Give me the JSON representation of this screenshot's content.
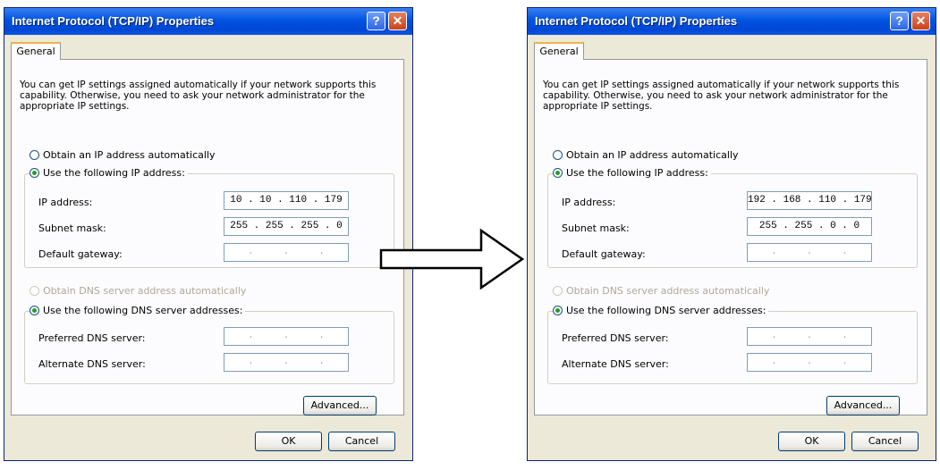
{
  "dialogs": [
    {
      "title": "Internet Protocol (TCP/IP) Properties",
      "help_glyph": "?",
      "close_glyph": "✕",
      "tab": "General",
      "description": "You can get IP settings assigned automatically if your network supports this capability. Otherwise, you need to ask your network administrator for the appropriate IP settings.",
      "radio_auto_ip": "Obtain an IP address automatically",
      "radio_manual_ip": "Use the following IP address:",
      "ip_label": "IP address:",
      "ip_value": "10 . 10 . 110 . 179",
      "subnet_label": "Subnet mask:",
      "subnet_value": "255 . 255 . 255 . 0",
      "gateway_label": "Default gateway:",
      "gateway_value": ".     .     .",
      "radio_auto_dns": "Obtain DNS server address automatically",
      "radio_manual_dns": "Use the following DNS server addresses:",
      "preferred_dns_label": "Preferred DNS server:",
      "preferred_dns_value": ".     .     .",
      "alternate_dns_label": "Alternate DNS server:",
      "alternate_dns_value": ".     .     .",
      "advanced_button": "Advanced...",
      "ok_button": "OK",
      "cancel_button": "Cancel"
    },
    {
      "title": "Internet Protocol (TCP/IP) Properties",
      "help_glyph": "?",
      "close_glyph": "✕",
      "tab": "General",
      "description": "You can get IP settings assigned automatically if your network supports this capability. Otherwise, you need to ask your network administrator for the appropriate IP settings.",
      "radio_auto_ip": "Obtain an IP address automatically",
      "radio_manual_ip": "Use the following IP address:",
      "ip_label": "IP address:",
      "ip_value": "192 . 168 . 110 . 179",
      "subnet_label": "Subnet mask:",
      "subnet_value": "255 . 255 . 0 . 0",
      "gateway_label": "Default gateway:",
      "gateway_value": ".     .     .",
      "radio_auto_dns": "Obtain DNS server address automatically",
      "radio_manual_dns": "Use the following DNS server addresses:",
      "preferred_dns_label": "Preferred DNS server:",
      "preferred_dns_value": ".     .     .",
      "alternate_dns_label": "Alternate DNS server:",
      "alternate_dns_value": ".     .     .",
      "advanced_button": "Advanced...",
      "ok_button": "OK",
      "cancel_button": "Cancel"
    }
  ],
  "arrow_icon": "right-arrow-icon",
  "colors": {
    "titlebar": "#0053e1",
    "dialog_bg": "#ece9d8",
    "radio_selected": "#21a121"
  }
}
